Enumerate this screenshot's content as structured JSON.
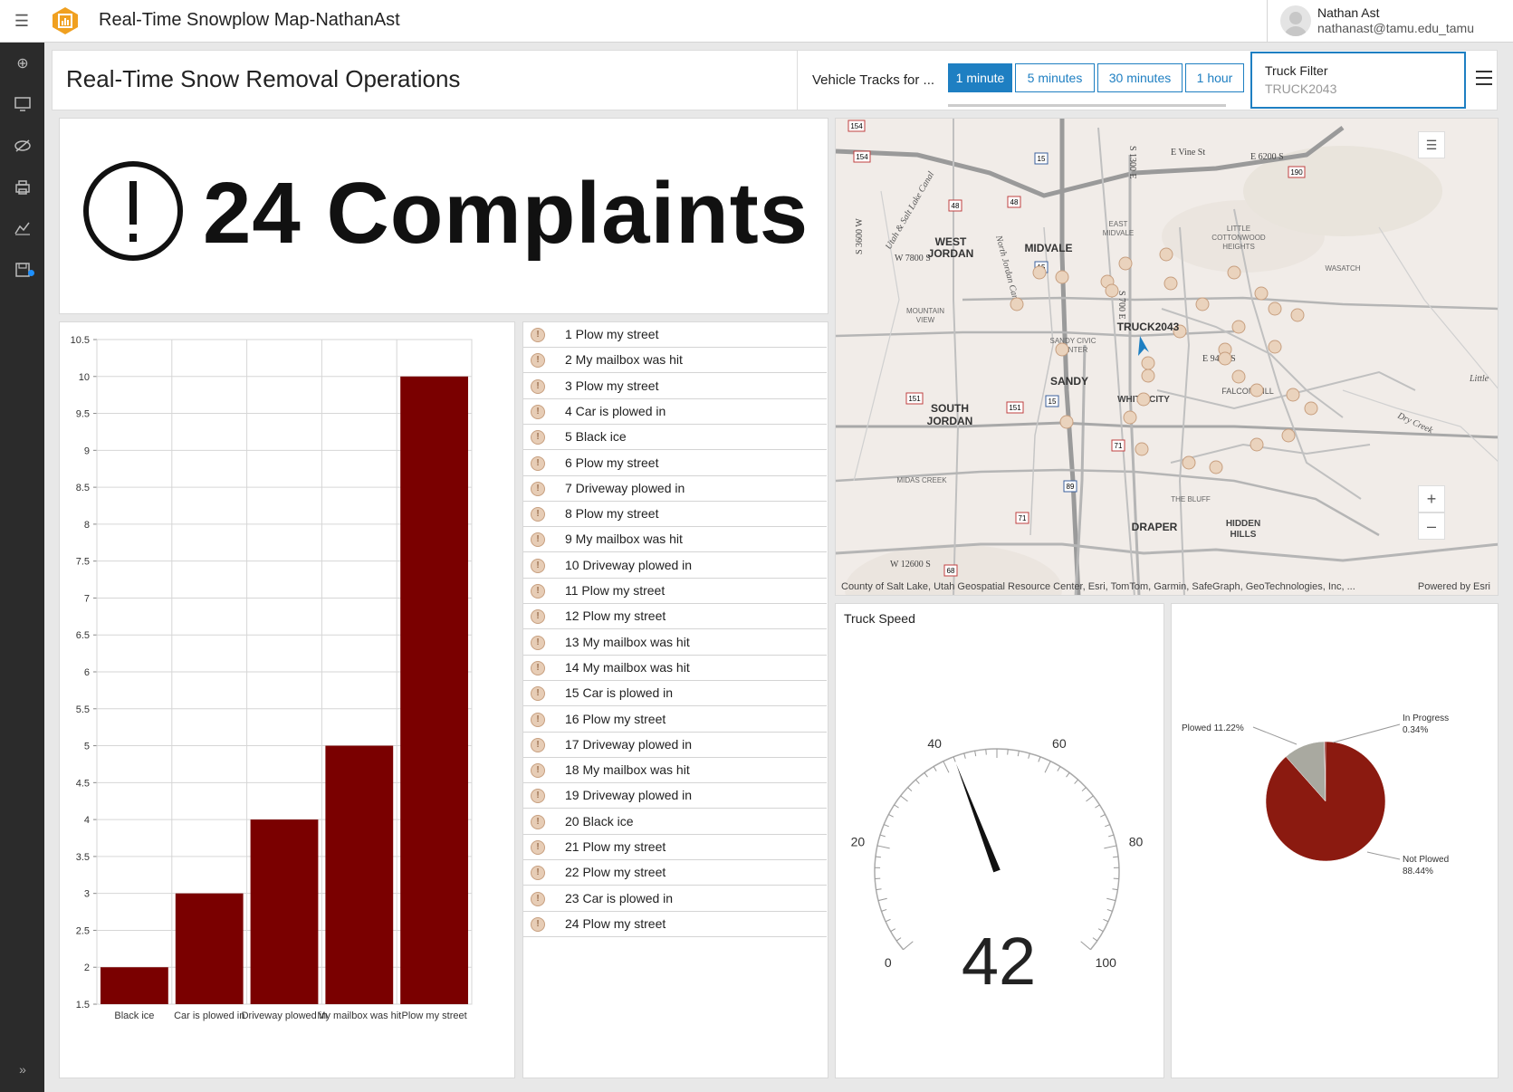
{
  "app": {
    "title": "Real-Time Snowplow Map-NathanAst",
    "user_name": "Nathan Ast",
    "user_email": "nathanast@tamu.edu_tamu"
  },
  "rail_icons": [
    "add-icon",
    "monitor-icon",
    "eye-off-icon",
    "print-icon",
    "chart-icon",
    "save-icon",
    "expand-icon"
  ],
  "header": {
    "title": "Real-Time Snow Removal Operations",
    "tracks_label": "Vehicle Tracks for ...",
    "track_options": [
      "1 minute",
      "5 minutes",
      "30 minutes",
      "1 hour"
    ],
    "selected_track": "1 minute",
    "filter_label": "Truck Filter",
    "filter_value": "TRUCK2043"
  },
  "indicator": {
    "text": "24 Complaints"
  },
  "bar_chart": {
    "chart_data": {
      "type": "bar",
      "categories": [
        "Black ice",
        "Car is plowed in",
        "Driveway plowed in",
        "My mailbox was hit",
        "Plow my street"
      ],
      "values": [
        2,
        3,
        4,
        5,
        10
      ],
      "ylim": [
        1.5,
        10.5
      ],
      "yticks": [
        "10.5",
        "10",
        "9.5",
        "9",
        "8.5",
        "8",
        "7.5",
        "7",
        "6.5",
        "6",
        "5.5",
        "5",
        "4.5",
        "4",
        "3.5",
        "3",
        "2.5",
        "2",
        "1.5"
      ],
      "bar_color": "#7a0000",
      "grid": true
    }
  },
  "complaints": [
    "1 Plow my street",
    "2 My mailbox was hit",
    "3 Plow my street",
    "4 Car is plowed in",
    "5 Black ice",
    "6 Plow my street",
    "7 Driveway plowed in",
    "8 Plow my street",
    "9 My mailbox was hit",
    "10 Driveway plowed in",
    "11 Plow my street",
    "12 Plow my street",
    "13 My mailbox was hit",
    "14 My mailbox was hit",
    "15 Car is plowed in",
    "16 Plow my street",
    "17 Driveway plowed in",
    "18 My mailbox was hit",
    "19 Driveway plowed in",
    "20 Black ice",
    "21 Plow my street",
    "22 Plow my street",
    "23 Car is plowed in",
    "24 Plow my street"
  ],
  "map": {
    "attribution": "County of Salt Lake, Utah Geospatial Resource Center, Esri, TomTom, Garmin, SafeGraph, GeoTechnologies, Inc, ...",
    "powered_by": "Powered by Esri",
    "truck_label": "TRUCK2043",
    "places": [
      "WEST JORDAN",
      "MIDVALE",
      "SANDY",
      "SOUTH JORDAN",
      "DRAPER",
      "HIDDEN HILLS",
      "FALCON HILL",
      "WHITE CITY",
      "LITTLE COTTONWOOD HEIGHTS",
      "WASATCH",
      "MIDAS CREEK",
      "MOUNTAIN VIEW",
      "EAST MIDVALE",
      "THE BLUFF",
      "SANDY CIVIC CENTER"
    ],
    "roads": [
      "E Vine St",
      "E 6200 S",
      "W 7800 S",
      "E 9400 S",
      "W 12600 S",
      "S 3600 W",
      "S 1300 E",
      "S 700 E",
      "Utah & Salt Lake Canal",
      "North Jordan Canal",
      "Dry Creek",
      "Little"
    ],
    "shields": [
      "154",
      "154",
      "15",
      "48",
      "48",
      "190",
      "15",
      "151",
      "151",
      "71",
      "89",
      "71",
      "68",
      "15"
    ]
  },
  "gauge": {
    "title": "Truck Speed",
    "value": "42",
    "min": 0,
    "max": 100,
    "tick_labels": [
      "0",
      "20",
      "40",
      "60",
      "80",
      "100"
    ]
  },
  "pie": {
    "chart_data": {
      "type": "pie",
      "slices": [
        {
          "label": "Plowed 11.22%",
          "value": 11.22,
          "color": "#a9a9a0"
        },
        {
          "label": "In Progress 0.34%",
          "value": 0.34,
          "color": "#7a0000"
        },
        {
          "label": "Not Plowed 88.44%",
          "value": 88.44,
          "color": "#8b1a10"
        }
      ]
    },
    "labels": {
      "plowed": "Plowed 11.22%",
      "in_progress_1": "In Progress",
      "in_progress_2": "0.34%",
      "not_plowed_1": "Not Plowed",
      "not_plowed_2": "88.44%"
    }
  },
  "colors": {
    "accent": "#1e7fc2",
    "bar": "#7a0000",
    "pie_main": "#8b1a10",
    "rail": "#2b2b2b"
  }
}
